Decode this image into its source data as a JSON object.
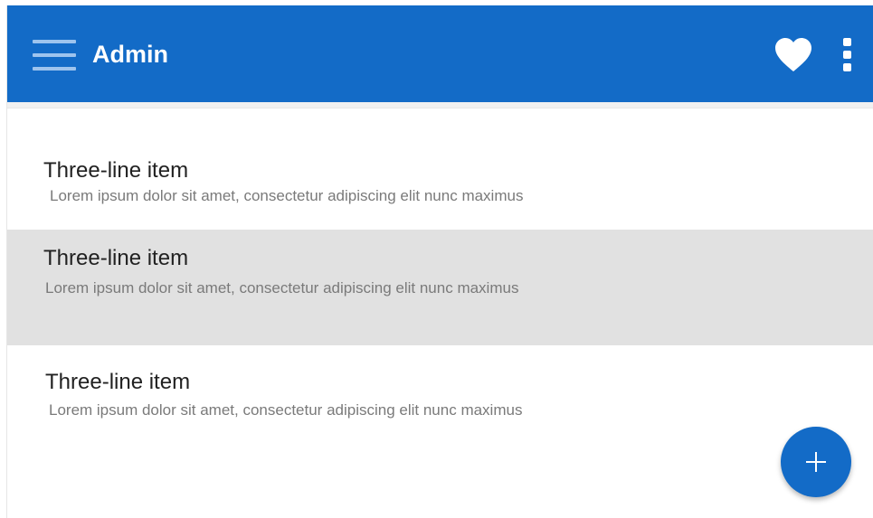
{
  "app_bar": {
    "title": "Admin",
    "menu_icon": "hamburger-menu-icon",
    "favorite_icon": "heart-icon",
    "overflow_icon": "more-vertical-icon",
    "background_color": "#136bc7"
  },
  "list": {
    "items": [
      {
        "title": "Three-line item",
        "subtitle": "Lorem ipsum dolor sit amet, consectetur adipiscing elit nunc maximus",
        "selected": false
      },
      {
        "title": "Three-line item",
        "subtitle": "Lorem ipsum dolor sit amet, consectetur adipiscing elit nunc maximus",
        "selected": true
      },
      {
        "title": "Three-line item",
        "subtitle": "Lorem ipsum dolor sit amet, consectetur adipiscing elit nunc maximus",
        "selected": false
      }
    ]
  },
  "fab": {
    "icon": "plus-icon",
    "color": "#136bc7"
  }
}
